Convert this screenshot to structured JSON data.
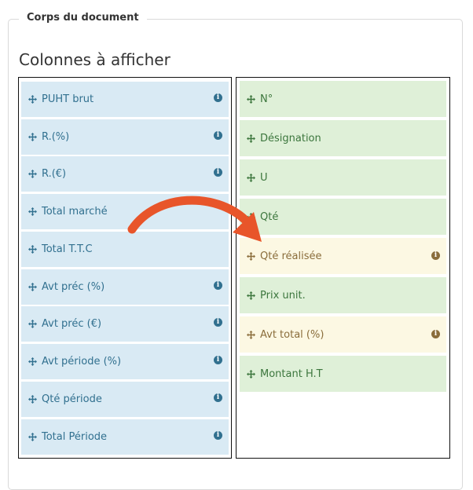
{
  "section": {
    "legend": "Corps du document",
    "title": "Colonnes à afficher"
  },
  "left_columns": [
    {
      "label": "PUHT brut",
      "info": true
    },
    {
      "label": "R.(%)",
      "info": true
    },
    {
      "label": "R.(€)",
      "info": true
    },
    {
      "label": "Total marché",
      "info": false
    },
    {
      "label": "Total T.T.C",
      "info": false
    },
    {
      "label": "Avt préc (%)",
      "info": true
    },
    {
      "label": "Avt préc (€)",
      "info": true
    },
    {
      "label": "Avt période (%)",
      "info": true
    },
    {
      "label": "Qté période",
      "info": true
    },
    {
      "label": "Total Période",
      "info": true
    }
  ],
  "right_columns": [
    {
      "label": "N°",
      "state": "green",
      "info": false
    },
    {
      "label": "Désignation",
      "state": "green",
      "info": false
    },
    {
      "label": "U",
      "state": "green",
      "info": false
    },
    {
      "label": "Qté",
      "state": "green",
      "info": false
    },
    {
      "label": "Qté réalisée",
      "state": "yellow",
      "info": true
    },
    {
      "label": "Prix unit.",
      "state": "green",
      "info": false
    },
    {
      "label": "Avt total (%)",
      "state": "yellow",
      "info": true
    },
    {
      "label": "Montant H.T",
      "state": "green",
      "info": false
    }
  ],
  "icons": {
    "move": "move-icon",
    "info": "info-icon",
    "arrow": "drag-arrow"
  },
  "colors": {
    "blue_bg": "#d9eaf4",
    "green_bg": "#dff0d8",
    "yellow_bg": "#fcf8e3",
    "arrow": "#e8552a"
  }
}
